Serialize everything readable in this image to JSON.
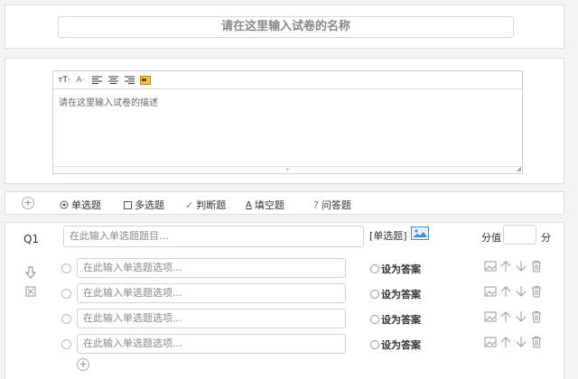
{
  "title_panel": {
    "placeholder": "请在这里输入试卷的名称"
  },
  "description": {
    "placeholder": "请在这里输入试卷的描述",
    "toolbar": [
      {
        "name": "font-size-icon",
        "label": "тT·"
      },
      {
        "name": "font-color-icon",
        "label": "A·"
      },
      {
        "name": "align-left-icon",
        "label": ""
      },
      {
        "name": "align-center-icon",
        "label": ""
      },
      {
        "name": "align-right-icon",
        "label": ""
      },
      {
        "name": "insert-image-icon",
        "label": ""
      }
    ]
  },
  "types": {
    "single": "单选题",
    "multi": "多选题",
    "judge": "判断题",
    "fill": "填空题",
    "essay": "问答题"
  },
  "question": {
    "number": "Q1",
    "title_placeholder": "在此输入单选题题目...",
    "type_label": "[单选题]",
    "score_label": "分值",
    "score_unit": "分",
    "options": [
      {
        "placeholder": "在此输入单选题选项...",
        "answer_label": "设为答案"
      },
      {
        "placeholder": "在此输入单选题选项...",
        "answer_label": "设为答案"
      },
      {
        "placeholder": "在此输入单选题选项...",
        "answer_label": "设为答案"
      },
      {
        "placeholder": "在此输入单选题选项...",
        "answer_label": "设为答案"
      }
    ]
  },
  "colors": {
    "accent": "#3f8fd6",
    "border": "#d2d2d2",
    "background": "#f3f3f3"
  }
}
